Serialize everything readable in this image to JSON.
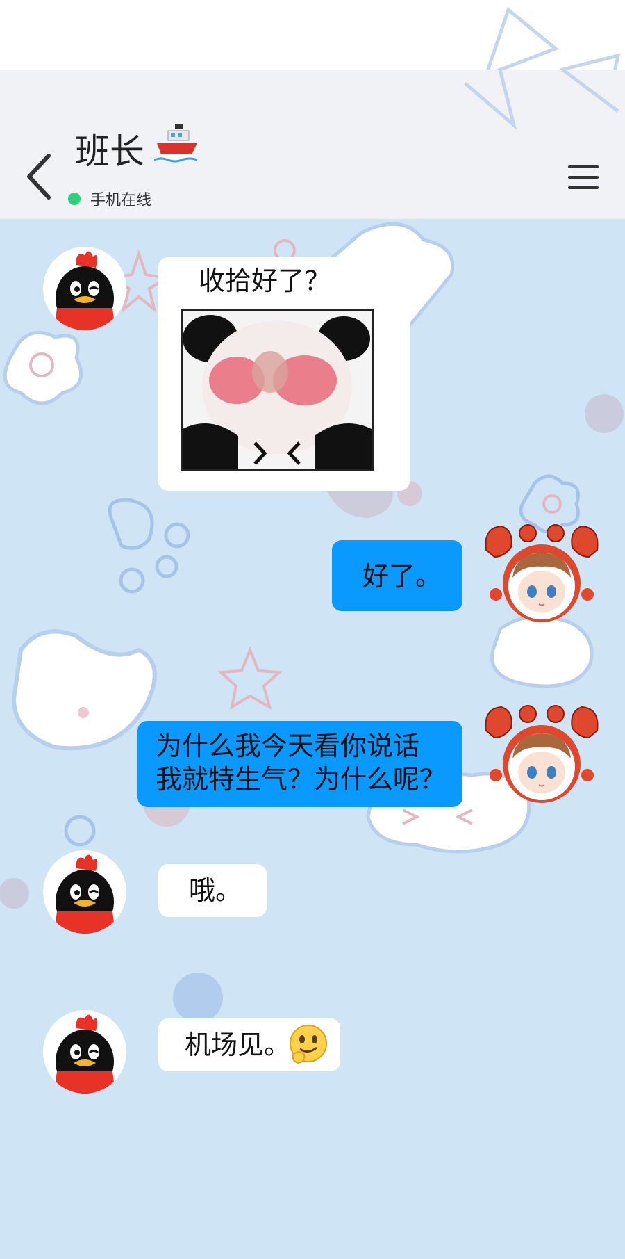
{
  "header": {
    "contact_name": "班长",
    "status": "手机在线"
  },
  "icons": {
    "back": "chevron-left-icon",
    "menu": "menu-icon",
    "title_emoji": "ship-icon",
    "online_dot": "online-dot-icon",
    "smile_emoji": "thinking-smile-icon"
  },
  "colors": {
    "chat_background": "#cfe4f4",
    "outgoing_bubble": "#0a99ff",
    "incoming_bubble": "#ffffff",
    "online_dot": "#2bd37b"
  },
  "messages": [
    {
      "direction": "incoming",
      "text": "收拾好了？",
      "sticker": "panda-meme-sticker"
    },
    {
      "direction": "outgoing",
      "text": "好了。"
    },
    {
      "direction": "outgoing",
      "lines": [
        "为什么我今天看你说话",
        "我就特生气？为什么呢？"
      ]
    },
    {
      "direction": "incoming",
      "text": "哦。"
    },
    {
      "direction": "incoming",
      "text": "机场见。"
    }
  ]
}
